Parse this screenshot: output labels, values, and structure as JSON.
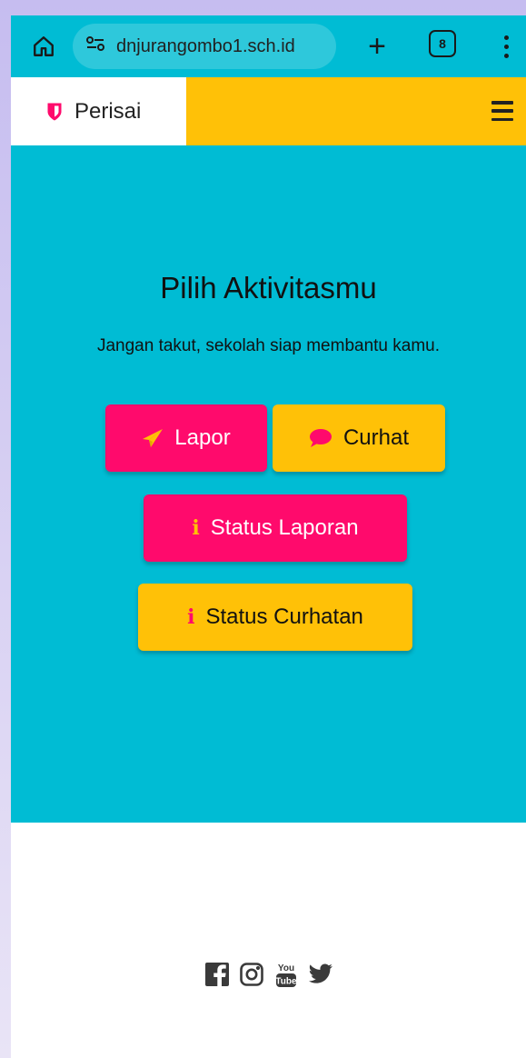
{
  "browser": {
    "url": "dnjurangombo1.sch.id",
    "tab_count": "8"
  },
  "navbar": {
    "brand": "Perisai"
  },
  "hero": {
    "title": "Pilih Aktivitasmu",
    "subtitle": "Jangan takut, sekolah siap membantu kamu.",
    "buttons": {
      "lapor": "Lapor",
      "curhat": "Curhat",
      "status_laporan": "Status Laporan",
      "status_curhatan": "Status Curhatan"
    },
    "info_glyph": "i"
  },
  "footer": {
    "social": [
      "facebook-icon",
      "instagram-icon",
      "youtube-icon",
      "twitter-icon"
    ]
  },
  "colors": {
    "teal": "#00bcd4",
    "yellow": "#ffc107",
    "pink": "#ff0a6c"
  }
}
